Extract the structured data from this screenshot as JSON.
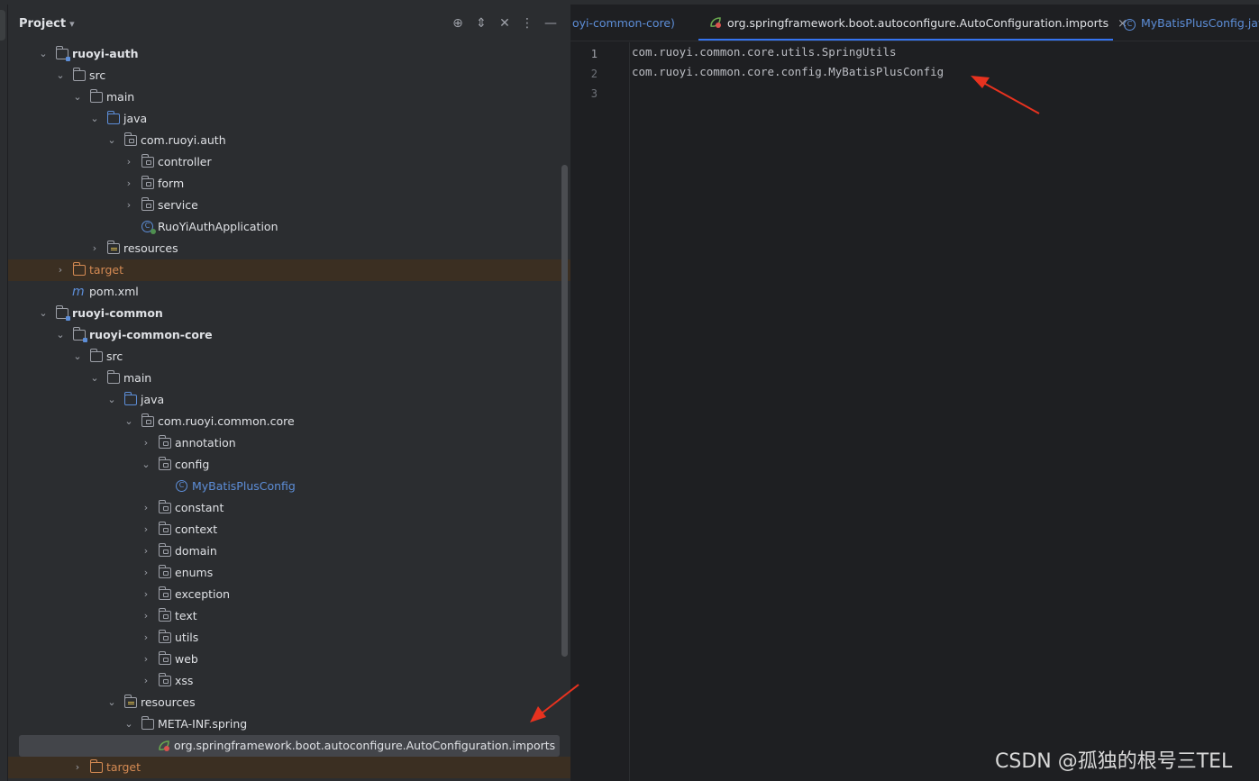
{
  "project_panel": {
    "title": "Project",
    "header_icons": [
      "locate-icon",
      "expand-all-icon",
      "collapse-all-icon",
      "more-options-icon",
      "hide-icon"
    ]
  },
  "tree": [
    {
      "label": "ruoyi-auth",
      "icon": "module-folder-icon",
      "bold": true
    },
    {
      "label": "src",
      "icon": "folder-icon"
    },
    {
      "label": "main",
      "icon": "folder-icon"
    },
    {
      "label": "java",
      "icon": "source-folder-icon"
    },
    {
      "label": "com.ruoyi.auth",
      "icon": "package-icon"
    },
    {
      "label": "controller",
      "icon": "package-icon"
    },
    {
      "label": "form",
      "icon": "package-icon"
    },
    {
      "label": "service",
      "icon": "package-icon"
    },
    {
      "label": "RuoYiAuthApplication",
      "icon": "spring-boot-class-icon"
    },
    {
      "label": "resources",
      "icon": "resources-folder-icon"
    },
    {
      "label": "target",
      "icon": "excluded-folder-icon"
    },
    {
      "label": "pom.xml",
      "icon": "maven-icon"
    },
    {
      "label": "ruoyi-common",
      "icon": "module-folder-icon",
      "bold": true
    },
    {
      "label": "ruoyi-common-core",
      "icon": "module-folder-icon",
      "bold": true
    },
    {
      "label": "src",
      "icon": "folder-icon"
    },
    {
      "label": "main",
      "icon": "folder-icon"
    },
    {
      "label": "java",
      "icon": "source-folder-icon"
    },
    {
      "label": "com.ruoyi.common.core",
      "icon": "package-icon"
    },
    {
      "label": "annotation",
      "icon": "package-icon"
    },
    {
      "label": "config",
      "icon": "package-icon"
    },
    {
      "label": "MyBatisPlusConfig",
      "icon": "class-icon"
    },
    {
      "label": "constant",
      "icon": "package-icon"
    },
    {
      "label": "context",
      "icon": "package-icon"
    },
    {
      "label": "domain",
      "icon": "package-icon"
    },
    {
      "label": "enums",
      "icon": "package-icon"
    },
    {
      "label": "exception",
      "icon": "package-icon"
    },
    {
      "label": "text",
      "icon": "package-icon"
    },
    {
      "label": "utils",
      "icon": "package-icon"
    },
    {
      "label": "web",
      "icon": "package-icon"
    },
    {
      "label": "xss",
      "icon": "package-icon"
    },
    {
      "label": "resources",
      "icon": "resources-folder-icon"
    },
    {
      "label": "META-INF.spring",
      "icon": "folder-icon"
    },
    {
      "label": "org.springframework.boot.autoconfigure.AutoConfiguration.imports",
      "icon": "spring-imports-file-icon"
    },
    {
      "label": "target",
      "icon": "excluded-folder-icon"
    }
  ],
  "editor": {
    "tabs": [
      {
        "label": "oyi-common-core)"
      },
      {
        "label": "org.springframework.boot.autoconfigure.AutoConfiguration.imports",
        "close": "×",
        "active": true
      },
      {
        "label": "MyBatisPlusConfig.java"
      }
    ],
    "lines": [
      {
        "number": "1",
        "text": "com.ruoyi.common.core.utils.SpringUtils"
      },
      {
        "number": "2",
        "text": "com.ruoyi.common.core.config.MyBatisPlusConfig"
      },
      {
        "number": "3",
        "text": ""
      }
    ]
  },
  "annotations": {
    "arrow_color": "#e8321f"
  },
  "watermark": "CSDN @孤独的根号三TEL"
}
